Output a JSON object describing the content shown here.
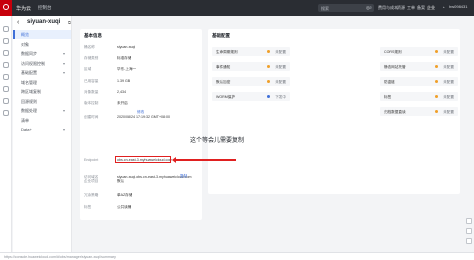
{
  "topbar": {
    "brand": "华为云",
    "region": "控制台",
    "search_placeholder": "搜索",
    "nav": [
      "费用与成本",
      "资源",
      "工单",
      "备案",
      "企业",
      "支持与服务"
    ],
    "user": "hw098431"
  },
  "sidebar": {
    "bucket_name": "siyuan-xuqi",
    "items": [
      {
        "label": "概览",
        "active": true,
        "chevron": false
      },
      {
        "label": "对象",
        "active": false,
        "chevron": false
      },
      {
        "label": "数据同步",
        "active": false,
        "chevron": true
      },
      {
        "label": "访问权限控制",
        "active": false,
        "chevron": true
      },
      {
        "label": "基础配置",
        "active": false,
        "chevron": true
      },
      {
        "label": "域名管理",
        "active": false,
        "chevron": false
      },
      {
        "label": "跨区域复制",
        "active": false,
        "chevron": false
      },
      {
        "label": "回源规则",
        "active": false,
        "chevron": false
      },
      {
        "label": "数据处理",
        "active": false,
        "chevron": true
      },
      {
        "label": "清单",
        "active": false,
        "chevron": false
      },
      {
        "label": "Data+",
        "active": false,
        "chevron": true
      }
    ]
  },
  "basic_info": {
    "title": "基本信息",
    "rows": [
      {
        "label": "桶名称",
        "value": "siyuan-xuqi"
      },
      {
        "label": "存储类别",
        "value": "标准存储"
      },
      {
        "label": "区域",
        "value": "华东-上海一"
      },
      {
        "label": "已用容量",
        "value": "1.39 GB"
      },
      {
        "label": "对象数量",
        "value": "2,434"
      },
      {
        "label": "版本控制",
        "value": "未开启"
      },
      {
        "label": "创建时间",
        "value": "2020/08/24 17:19:32 GMT+08:00"
      },
      {
        "label": "Endpoint",
        "value": "obs.cn-east-3.myhuaweicloud.com"
      },
      {
        "label": "访问域名",
        "value": "siyuan-xuqi.obs.cn-east-3.myhuaweicloud.com"
      },
      {
        "label": "企业项目",
        "value": "默认"
      },
      {
        "label": "冗余策略",
        "value": "单AZ存储"
      },
      {
        "label": "标签",
        "value": "公共读桶"
      }
    ],
    "change_link": "修改",
    "copy_link": "复制"
  },
  "annotation": "这个等会儿需要复制",
  "config": {
    "title": "基础配置",
    "items": [
      {
        "name": "生命周期规则",
        "status": "未配置",
        "color": "#f0a029"
      },
      {
        "name": "CORS规则",
        "status": "未配置",
        "color": "#f0a029"
      },
      {
        "name": "事件通知",
        "status": "未配置",
        "color": "#f0a029"
      },
      {
        "name": "默认加密",
        "status": "未配置",
        "color": "#f0a029"
      },
      {
        "name": "WORM保护",
        "status": "下发中",
        "color": "#3f6fd8"
      },
      {
        "name": "静态网站托管",
        "status": "未配置",
        "color": "#f0a029"
      },
      {
        "name": "防盗链",
        "status": "未配置",
        "color": "#f0a029"
      },
      {
        "name": "标签",
        "status": "未配置",
        "color": "#f0a029"
      },
      {
        "name": "归档数据直读",
        "status": "未配置",
        "color": "#f0a029"
      }
    ]
  },
  "status_url": "https://console.huaweicloud.com/#/obs/manager/siyuan-xuqi/summary"
}
